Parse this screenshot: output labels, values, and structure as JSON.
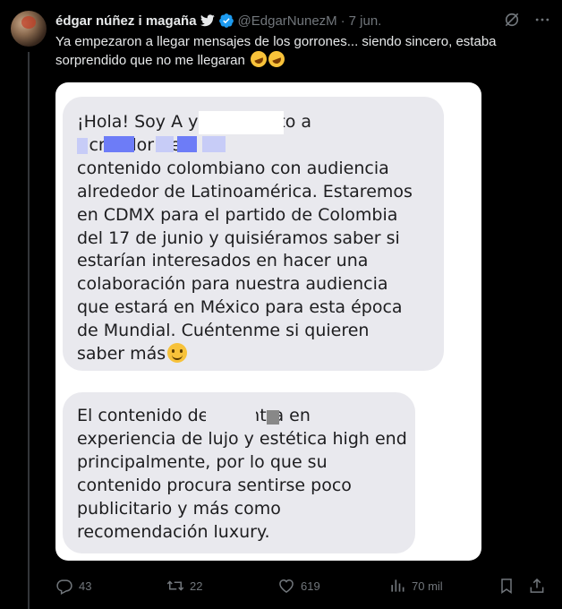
{
  "tweet": {
    "author_name": "édgar núñez i magaña",
    "handle": "@EdgarNunezM",
    "separator": "·",
    "time": "7 jun.",
    "text": "Ya empezaron a llegar mensajes de los gorrones... siendo sincero, estaba sorprendido que no me llegaran",
    "emoji": "rolling-on-floor-laughing"
  },
  "media": {
    "message1": "¡Hola! Soy A              y represento a\n(                         creador de\ncontenido colombiano con audiencia\nalrededor de Latinoamérica. Estaremos\nen CDMX para el partido de Colombia\ndel 17 de junio y quisiéramos saber si\nestarían interesados en hacer una\ncolaboración para nuestra audiencia\nque estará en México para esta época\nde Mundial. Cuéntenme si quieren\nsaber más",
    "message2": "El contenido de L           centra en\nexperiencia de lujo y estética high end\nprincipalmente, por lo que su\ncontenido procura sentirse poco\npublicitario y más como\nrecomendación luxury."
  },
  "actions": {
    "replies": "43",
    "retweets": "22",
    "likes": "619",
    "views": "70 mil"
  },
  "colors": {
    "background": "#000000",
    "text": "#e7e9ea",
    "muted": "#71767b",
    "verified": "#1d9bf0",
    "bubble": "#e9e9ee"
  }
}
